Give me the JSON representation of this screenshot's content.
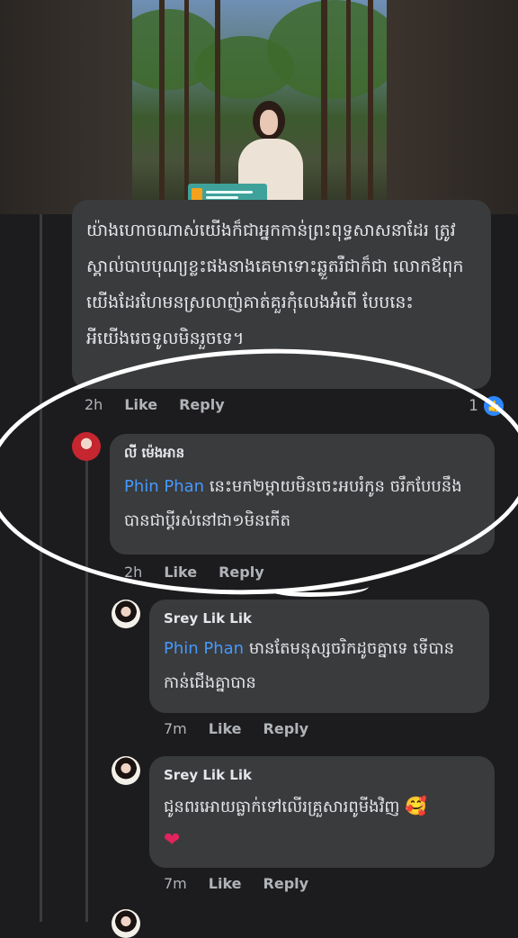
{
  "photo": {
    "tag_label": "ចែករំលែក",
    "tag_sub": "tel: 012"
  },
  "main_comment": {
    "text": "យ៉ាងហោចណាស់យើងក៏ជាអ្នកកាន់ព្រះពុទ្ធសាសនាដែរ ត្រូវស្គាល់បាបបុណ្យខ្លះផងនាងគេមាទោះឆ្លួតរឺជាក៏ជា លោកឪពុកយើងដែរហែមនស្រលាញ់គាត់គួរកុំលេងអំពើ បែបនេះអីយើងរេចទូលមិនរួចទេ។",
    "time": "2h",
    "like_label": "Like",
    "reply_label": "Reply",
    "like_count": "1"
  },
  "reply1": {
    "author": "លី ម៉េងអាន",
    "mention": "Phin Phan",
    "text_after_mention": " នេះមក២ម្ដាយមិនចេះអបរំកូន ចរឹកបែបនឹងបានជាប្ដីរស់នៅជា១មិនកើត",
    "time": "2h",
    "like_label": "Like",
    "reply_label": "Reply"
  },
  "reply2": {
    "author": "Srey Lik Lik",
    "mention": "Phin Phan",
    "text_after_mention": " មានតែមនុស្សចរិកដូចគ្នាទេ ទើបានកាន់ជើងគ្នាបាន",
    "time": "7m",
    "like_label": "Like",
    "reply_label": "Reply"
  },
  "reply3": {
    "author": "Srey Lik Lik",
    "text": "ជូនពរអោយធ្លាក់ទៅលើរគ្រួសារពូមីងវិញ",
    "emoji": "🥰",
    "heart": "❤",
    "time": "7m",
    "like_label": "Like",
    "reply_label": "Reply"
  },
  "colors": {
    "background": "#1c1c1e",
    "bubble": "#3a3b3c",
    "mention": "#4599ff",
    "like_badge": "#2d88ff"
  }
}
